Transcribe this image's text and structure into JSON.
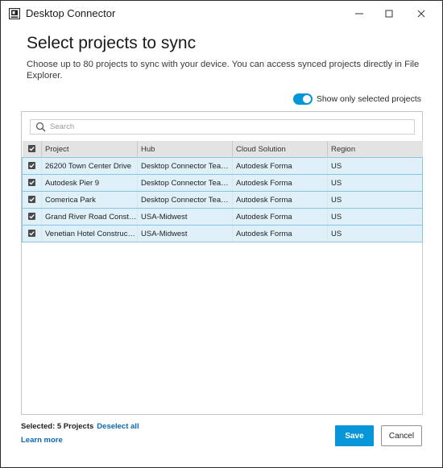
{
  "window": {
    "title": "Desktop Connector"
  },
  "heading": "Select projects to sync",
  "description": "Choose up to 80 projects to sync with your device. You can access synced projects directly in File Explorer.",
  "toggle": {
    "label": "Show only selected projects",
    "on": true
  },
  "search": {
    "placeholder": "Search",
    "value": ""
  },
  "table": {
    "columns": [
      "Project",
      "Hub",
      "Cloud Solution",
      "Region"
    ],
    "rows": [
      {
        "project": "26200 Town Center Drive",
        "hub": "Desktop Connector Team...",
        "cloud": "Autodesk Forma",
        "region": "US",
        "checked": true
      },
      {
        "project": "Autodesk Pier 9",
        "hub": "Desktop Connector Team...",
        "cloud": "Autodesk Forma",
        "region": "US",
        "checked": true
      },
      {
        "project": "Comerica Park",
        "hub": "Desktop Connector Team...",
        "cloud": "Autodesk Forma",
        "region": "US",
        "checked": true
      },
      {
        "project": "Grand River Road Constru...",
        "hub": "USA-Midwest",
        "cloud": "Autodesk Forma",
        "region": "US",
        "checked": true
      },
      {
        "project": "Venetian Hotel Construction",
        "hub": "USA-Midwest",
        "cloud": "Autodesk Forma",
        "region": "US",
        "checked": true
      }
    ]
  },
  "footer": {
    "selected_text": "Selected: 5 Projects",
    "deselect_label": "Deselect all",
    "learn_more_label": "Learn more",
    "save_label": "Save",
    "cancel_label": "Cancel"
  },
  "colors": {
    "accent": "#0696d7",
    "link": "#0a68b4",
    "row_selected_bg": "#dff0f8",
    "row_selected_border": "#88c4e3"
  }
}
